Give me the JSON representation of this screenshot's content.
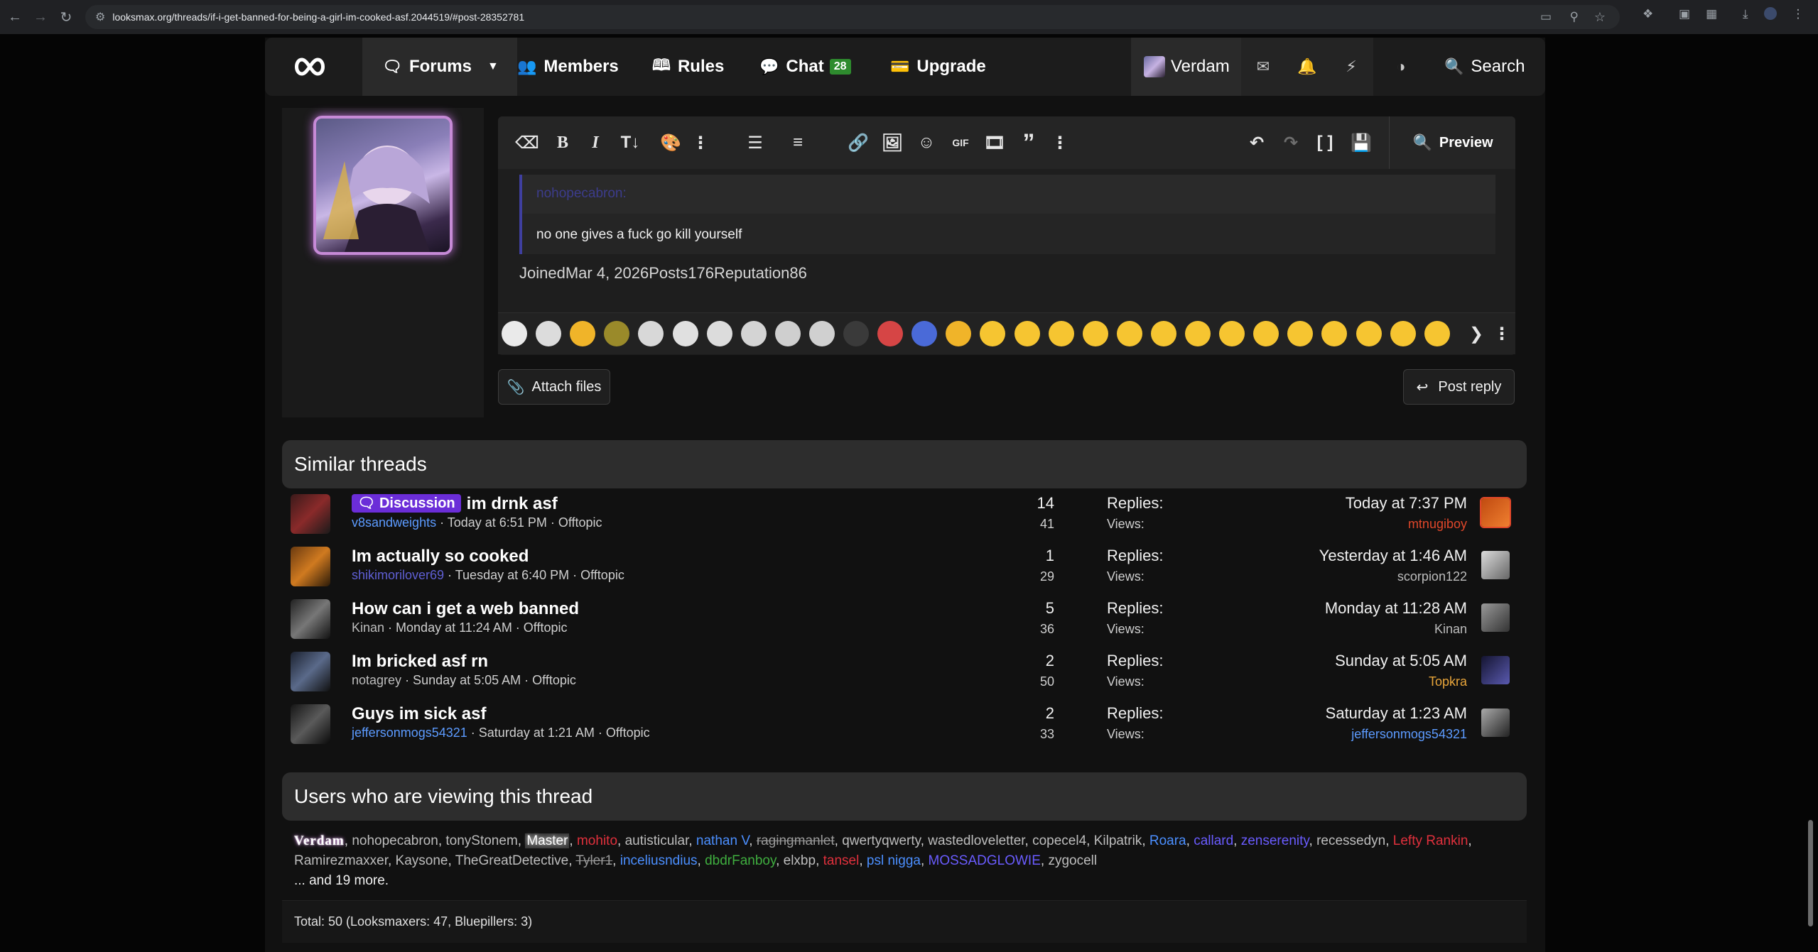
{
  "browser": {
    "url": "looksmax.org/threads/if-i-get-banned-for-being-a-girl-im-cooked-asf.2044519/#post-28352781"
  },
  "navbar": {
    "forums": "Forums",
    "members": "Members",
    "rules": "Rules",
    "chat": "Chat",
    "chat_count": "28",
    "upgrade": "Upgrade",
    "username": "Verdam",
    "search": "Search"
  },
  "editor": {
    "preview": "Preview",
    "quote_author": "nohopecabron:",
    "quote_text": "no one gives a fuck go kill yourself",
    "stats_line": "JoinedMar 4, 2026Posts176Reputation86",
    "attach_files": "Attach files",
    "post_reply": "Post reply"
  },
  "similar_threads": {
    "heading": "Similar threads",
    "replies_label": "Replies:",
    "views_label": "Views:",
    "threads": [
      {
        "prefix": "Discussion",
        "title": "im drnk asf",
        "author": "v8sandweights",
        "author_color": "#5c9bff",
        "date": "Today at 6:51 PM",
        "forum": "Offtopic",
        "replies": "14",
        "views": "41",
        "last_date": "Today at 7:37 PM",
        "last_user": "mtnugiboy",
        "last_user_color": "#e0472a"
      },
      {
        "prefix": "",
        "title": "Im actually so cooked",
        "author": "shikimorilover69",
        "author_color": "#5f5fd4",
        "date": "Tuesday at 6:40 PM",
        "forum": "Offtopic",
        "replies": "1",
        "views": "29",
        "last_date": "Yesterday at 1:46 AM",
        "last_user": "scorpion122",
        "last_user_color": "#bdbdbd"
      },
      {
        "prefix": "",
        "title": "How can i get a web banned",
        "author": "Kinan",
        "author_color": "#bdbdbd",
        "date": "Monday at 11:24 AM",
        "forum": "Offtopic",
        "replies": "5",
        "views": "36",
        "last_date": "Monday at 11:28 AM",
        "last_user": "Kinan",
        "last_user_color": "#bdbdbd"
      },
      {
        "prefix": "",
        "title": "Im bricked asf rn",
        "author": "notagrey",
        "author_color": "#bdbdbd",
        "date": "Sunday at 5:05 AM",
        "forum": "Offtopic",
        "replies": "2",
        "views": "50",
        "last_date": "Sunday at 5:05 AM",
        "last_user": "Topkra",
        "last_user_color": "#e8a53a"
      },
      {
        "prefix": "",
        "title": "Guys im sick asf",
        "author": "jeffersonmogs54321",
        "author_color": "#5c9bff",
        "date": "Saturday at 1:21 AM",
        "forum": "Offtopic",
        "replies": "2",
        "views": "33",
        "last_date": "Saturday at 1:23 AM",
        "last_user": "jeffersonmogs54321",
        "last_user_color": "#5c9bff"
      }
    ]
  },
  "viewers": {
    "heading": "Users who are viewing this thread",
    "users": [
      {
        "name": "Verdam",
        "color": "#ffffff",
        "style": "glow"
      },
      {
        "name": "nohopecabron",
        "color": "#bdbdbd",
        "style": ""
      },
      {
        "name": "tonyStonem",
        "color": "#bdbdbd",
        "style": ""
      },
      {
        "name": "Master",
        "color": "#ffffff",
        "style": "highlight"
      },
      {
        "name": "mohito",
        "color": "#e0303c",
        "style": ""
      },
      {
        "name": "autisticular",
        "color": "#bdbdbd",
        "style": ""
      },
      {
        "name": "nathan V",
        "color": "#4b8fff",
        "style": ""
      },
      {
        "name": "ragingmanlet",
        "color": "#9a9a9a",
        "style": "strike"
      },
      {
        "name": "qwertyqwerty",
        "color": "#bdbdbd",
        "style": ""
      },
      {
        "name": "wastedloveletter",
        "color": "#bdbdbd",
        "style": ""
      },
      {
        "name": "copecel4",
        "color": "#bdbdbd",
        "style": ""
      },
      {
        "name": "Kilpatrik",
        "color": "#bdbdbd",
        "style": ""
      },
      {
        "name": "Roara",
        "color": "#4b8fff",
        "style": ""
      },
      {
        "name": "callard",
        "color": "#6a5cff",
        "style": ""
      },
      {
        "name": "zenserenity",
        "color": "#6a5cff",
        "style": ""
      },
      {
        "name": "recessedyn",
        "color": "#bdbdbd",
        "style": ""
      },
      {
        "name": "Lefty Rankin",
        "color": "#e0303c",
        "style": ""
      },
      {
        "name": "Ramirezmaxxer",
        "color": "#bdbdbd",
        "style": ""
      },
      {
        "name": "Kaysone",
        "color": "#bdbdbd",
        "style": ""
      },
      {
        "name": "TheGreatDetective",
        "color": "#bdbdbd",
        "style": ""
      },
      {
        "name": "Tyler1",
        "color": "#9a9a9a",
        "style": "strike"
      },
      {
        "name": "inceliusndius",
        "color": "#4b8fff",
        "style": ""
      },
      {
        "name": "dbdrFanboy",
        "color": "#3fae3f",
        "style": ""
      },
      {
        "name": "elxbp",
        "color": "#bdbdbd",
        "style": ""
      },
      {
        "name": "tansel",
        "color": "#e0303c",
        "style": ""
      },
      {
        "name": "psl nigga",
        "color": "#4b8fff",
        "style": ""
      },
      {
        "name": "MOSSADGLOWIE",
        "color": "#6a5cff",
        "style": ""
      },
      {
        "name": "zygocell",
        "color": "#bdbdbd",
        "style": ""
      }
    ],
    "more": "... and 19 more.",
    "total": "Total: 50 (Looksmaxers: 47, Bluepillers: 3)"
  }
}
